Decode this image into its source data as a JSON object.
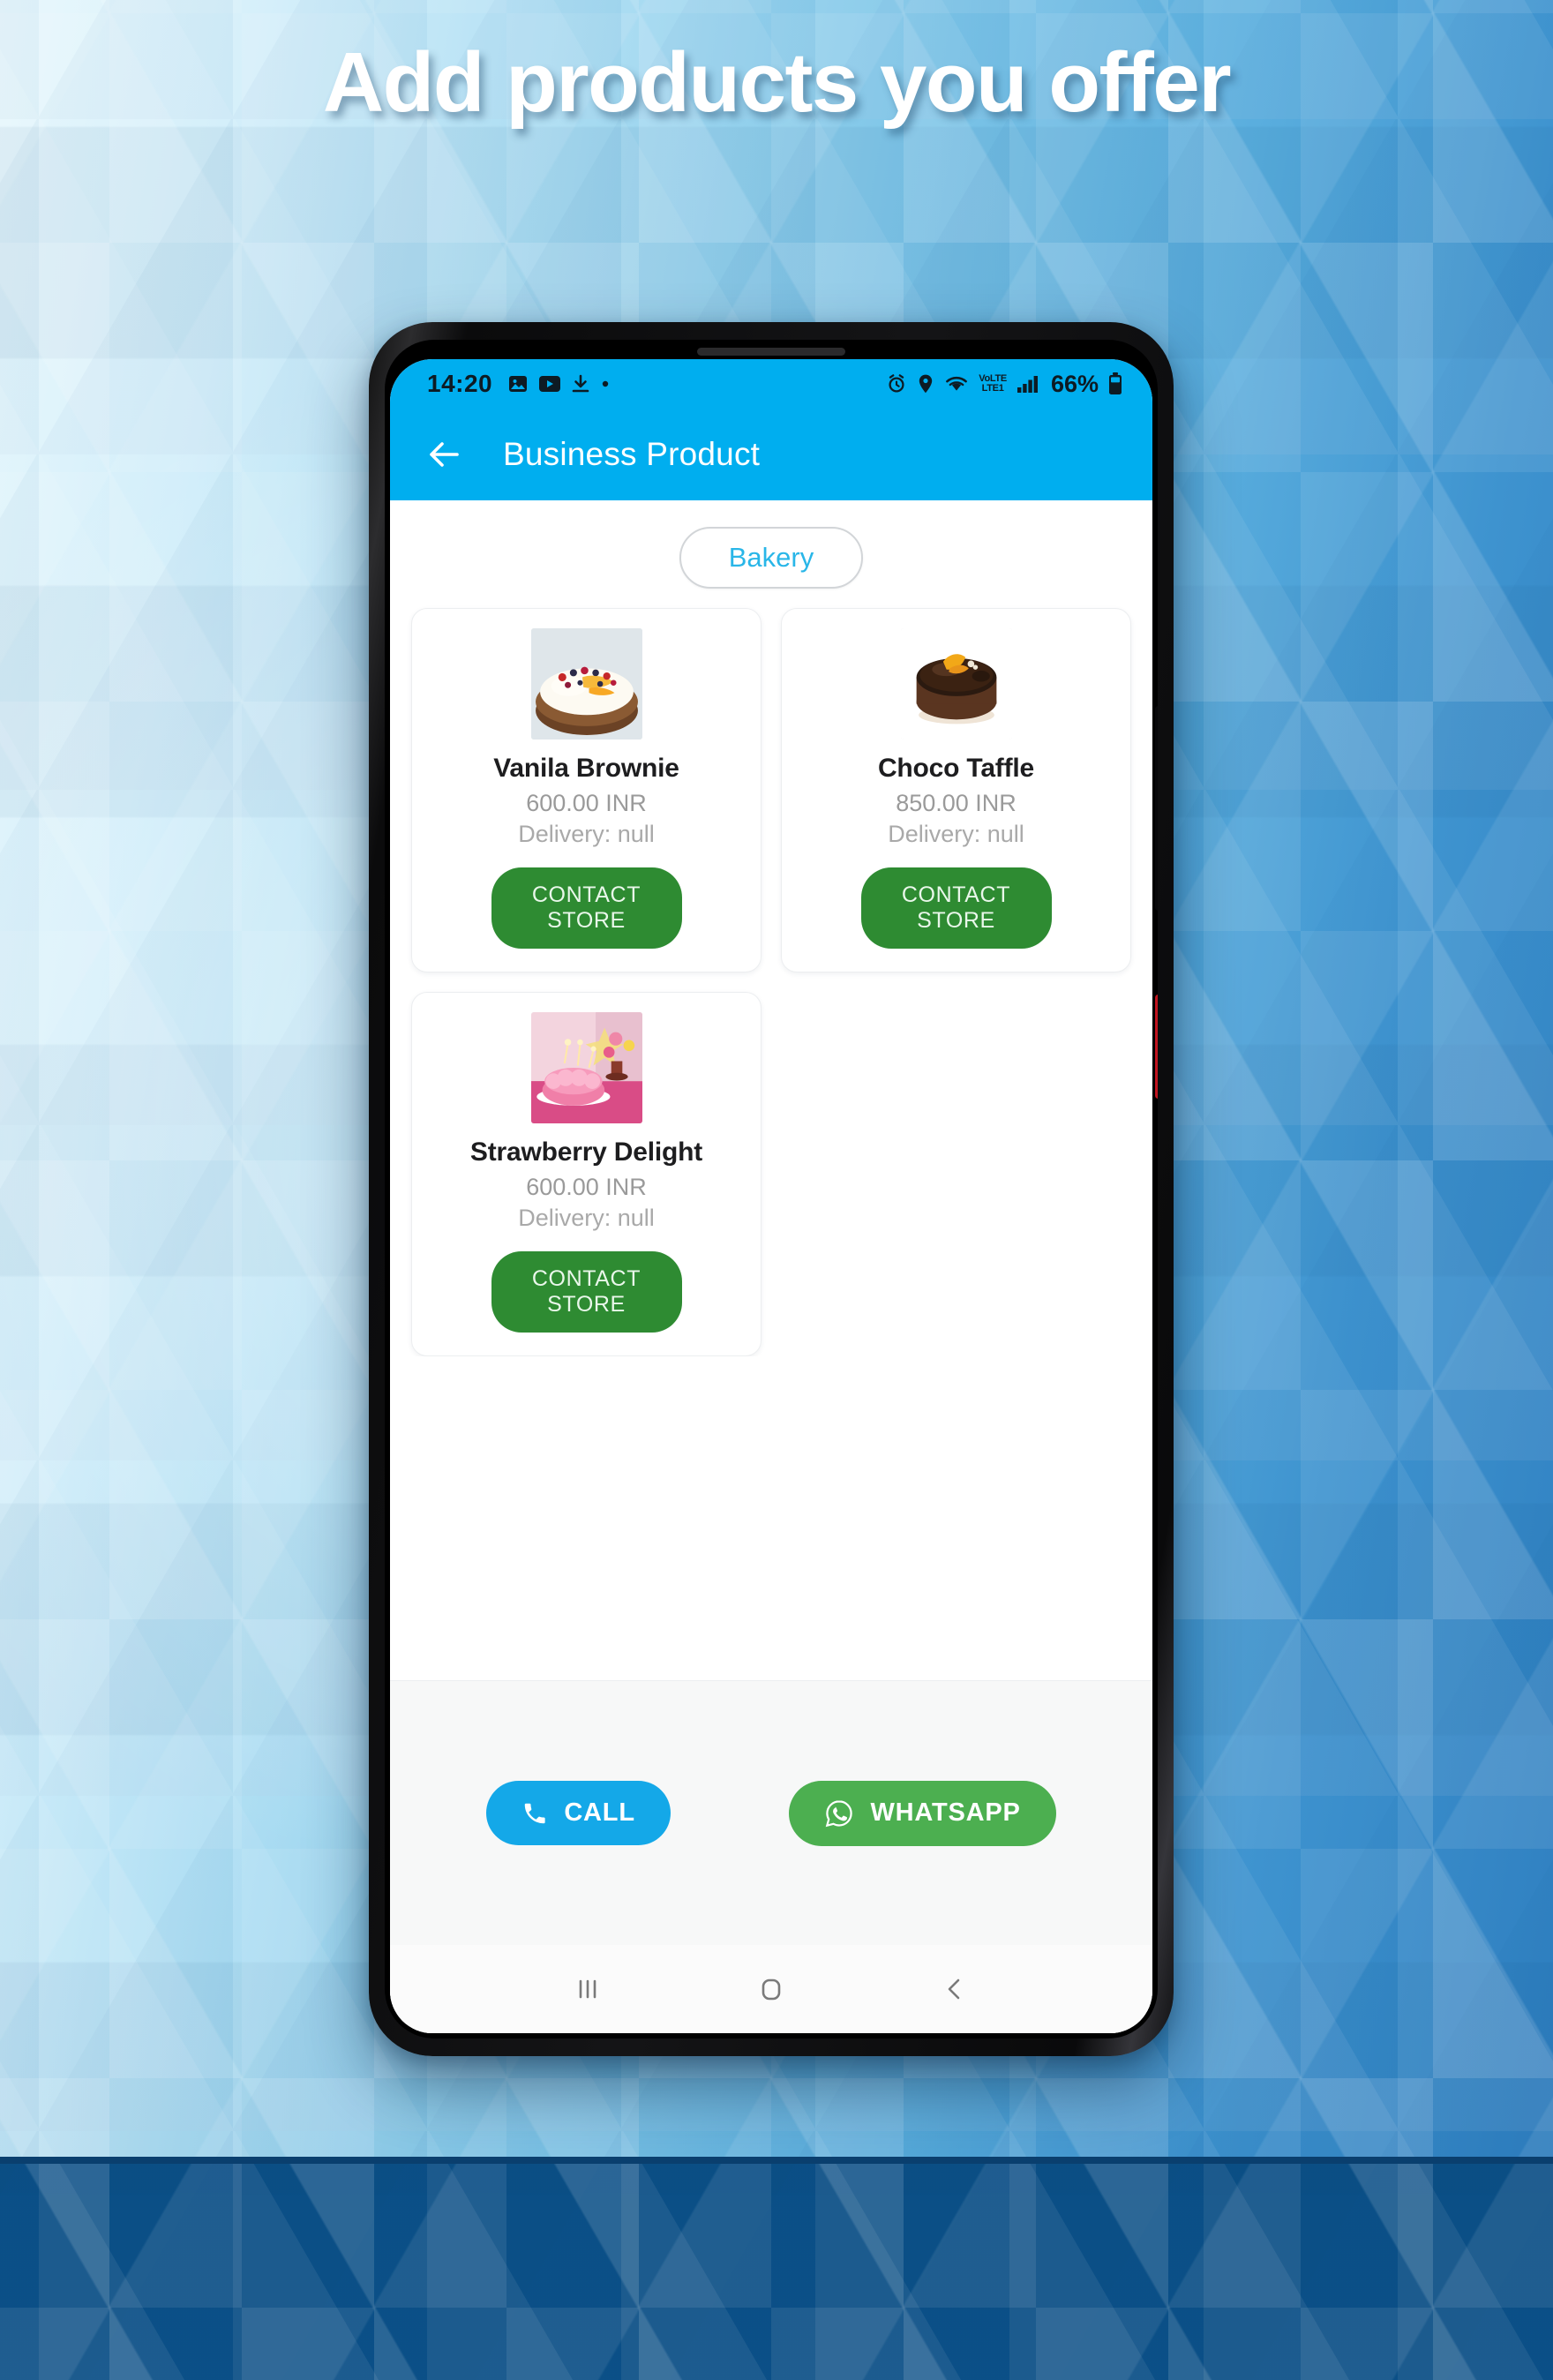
{
  "promo": {
    "headline": "Add products you offer",
    "background_color_left": "#e8f7fc",
    "background_color_right": "#2f7fc0",
    "headline_color": "#ffffff"
  },
  "phone": {
    "accent_color": "#00aeef",
    "power_button_color": "#d21b27"
  },
  "status_bar": {
    "time": "14:20",
    "battery_percent": "66%",
    "network_label_top": "VoLTE",
    "network_label_bottom": "LTE1",
    "left_icons": [
      "gallery-icon",
      "youtube-icon",
      "download-icon",
      "dot-icon"
    ],
    "right_icons": [
      "alarm-icon",
      "location-icon",
      "wifi-icon",
      "volte-icon",
      "signal-icon",
      "battery-icon"
    ]
  },
  "app_bar": {
    "back_icon": "arrow-left-icon",
    "title": "Business Product"
  },
  "category": {
    "chip_label": "Bakery",
    "chip_text_color": "#29b6e8"
  },
  "products": [
    {
      "name": "Vanila Brownie",
      "price": "600.00 INR",
      "delivery": "Delivery: null",
      "button_label": "CONTACT STORE",
      "image_alt": "cream tart with berries and mango drizzle"
    },
    {
      "name": "Choco Taffle",
      "price": "850.00 INR",
      "delivery": "Delivery: null",
      "button_label": "CONTACT STORE",
      "image_alt": "chocolate glazed cake with orange garnish"
    },
    {
      "name": "Strawberry Delight",
      "price": "600.00 INR",
      "delivery": "Delivery: null",
      "button_label": "CONTACT STORE",
      "image_alt": "pink frosted cake with sparklers and flowers"
    }
  ],
  "actions": {
    "call_label": "CALL",
    "call_icon": "phone-icon",
    "call_color": "#14a8e8",
    "whatsapp_label": "WHATSAPP",
    "whatsapp_icon": "whatsapp-icon",
    "whatsapp_color": "#4caf50"
  },
  "nav_bar": {
    "recents_icon": "recents-icon",
    "home_icon": "home-icon",
    "back_icon": "back-chevron-icon"
  },
  "contact_button_color": "#2e8b32"
}
